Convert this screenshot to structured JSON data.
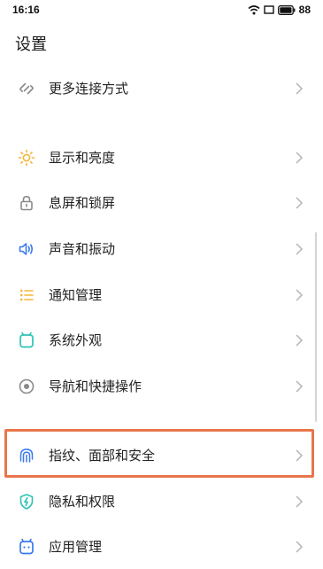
{
  "status_bar": {
    "time": "16:16",
    "battery": "88",
    "icons": [
      "wifi-icon",
      "screen-icon",
      "battery-icon"
    ]
  },
  "page": {
    "title": "设置"
  },
  "settings_items": [
    {
      "label": "更多连接方式",
      "icon": "link-icon",
      "color": "#8a8a8a"
    },
    {
      "label": "显示和亮度",
      "icon": "sun-icon",
      "color": "#f3b53a"
    },
    {
      "label": "息屏和锁屏",
      "icon": "lock-icon",
      "color": "#8a8a8a"
    },
    {
      "label": "声音和振动",
      "icon": "speaker-icon",
      "color": "#3a7af0"
    },
    {
      "label": "通知管理",
      "icon": "list-icon",
      "color": "#f3b53a"
    },
    {
      "label": "系统外观",
      "icon": "appearance-icon",
      "color": "#2cc3b4"
    },
    {
      "label": "导航和快捷操作",
      "icon": "navigation-icon",
      "color": "#8a8a8a"
    },
    {
      "label": "指纹、面部和安全",
      "icon": "fingerprint-icon",
      "color": "#3a7af0"
    },
    {
      "label": "隐私和权限",
      "icon": "shield-icon",
      "color": "#2cc3b4"
    },
    {
      "label": "应用管理",
      "icon": "app-icon",
      "color": "#3a7af0"
    }
  ],
  "highlight": {
    "color": "#e8764a"
  }
}
